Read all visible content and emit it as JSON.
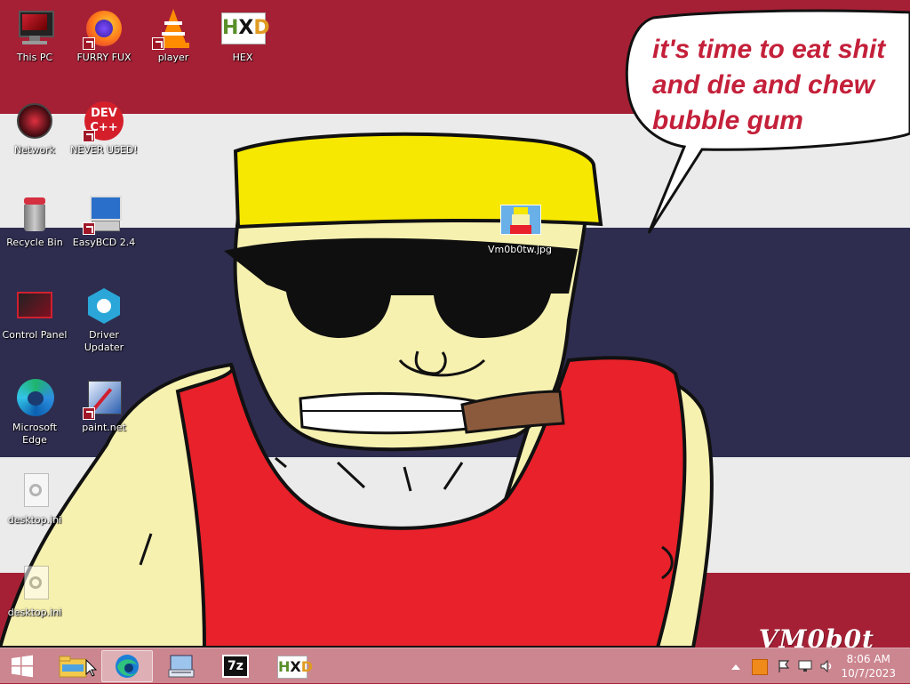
{
  "desktop": {
    "icons": [
      {
        "label": "This PC",
        "icon": "computer-icon"
      },
      {
        "label": "FURRY FUX",
        "icon": "firefox-icon"
      },
      {
        "label": "player",
        "icon": "vlc-cone-icon"
      },
      {
        "label": "HEX",
        "icon": "hxd-icon"
      },
      {
        "label": "Network",
        "icon": "network-icon"
      },
      {
        "label": "NEVER USED!",
        "icon": "dev-cpp-icon"
      },
      {
        "label": "Recycle Bin",
        "icon": "recycle-bin-icon"
      },
      {
        "label": "EasyBCD 2.4",
        "icon": "easybcd-icon"
      },
      {
        "label": "Control Panel",
        "icon": "control-panel-icon"
      },
      {
        "label": "Driver Updater",
        "icon": "driver-updater-icon"
      },
      {
        "label": "Microsoft Edge",
        "icon": "edge-icon"
      },
      {
        "label": "paint.net",
        "icon": "paintnet-icon"
      },
      {
        "label": "desktop.ini",
        "icon": "settings-file-icon"
      },
      {
        "label": "desktop.ini",
        "icon": "settings-file-icon"
      },
      {
        "label": "Vm0b0tw.jpg",
        "icon": "image-file-icon"
      }
    ]
  },
  "wallpaper": {
    "speech_bubble": [
      "it's time to eat shit",
      "and die and chew",
      "bubble gum"
    ],
    "watermark": "VM0b0t",
    "colors": {
      "red": "#a52035",
      "white": "#ebebeb",
      "navy": "#2e2d4f"
    }
  },
  "taskbar": {
    "start": "windows-logo-icon",
    "pinned": [
      {
        "name": "file-explorer-icon"
      },
      {
        "name": "edge-icon",
        "active": true
      },
      {
        "name": "on-screen-keyboard-icon"
      },
      {
        "name": "7zip-icon",
        "text": "7z"
      },
      {
        "name": "hxd-icon"
      }
    ],
    "tray": {
      "show_hidden": "chevron-up-icon",
      "icons": [
        "tray-app-icon",
        "action-center-flag-icon",
        "network-tray-icon",
        "volume-icon"
      ],
      "time": "8:06 AM",
      "date": "10/7/2023"
    }
  }
}
